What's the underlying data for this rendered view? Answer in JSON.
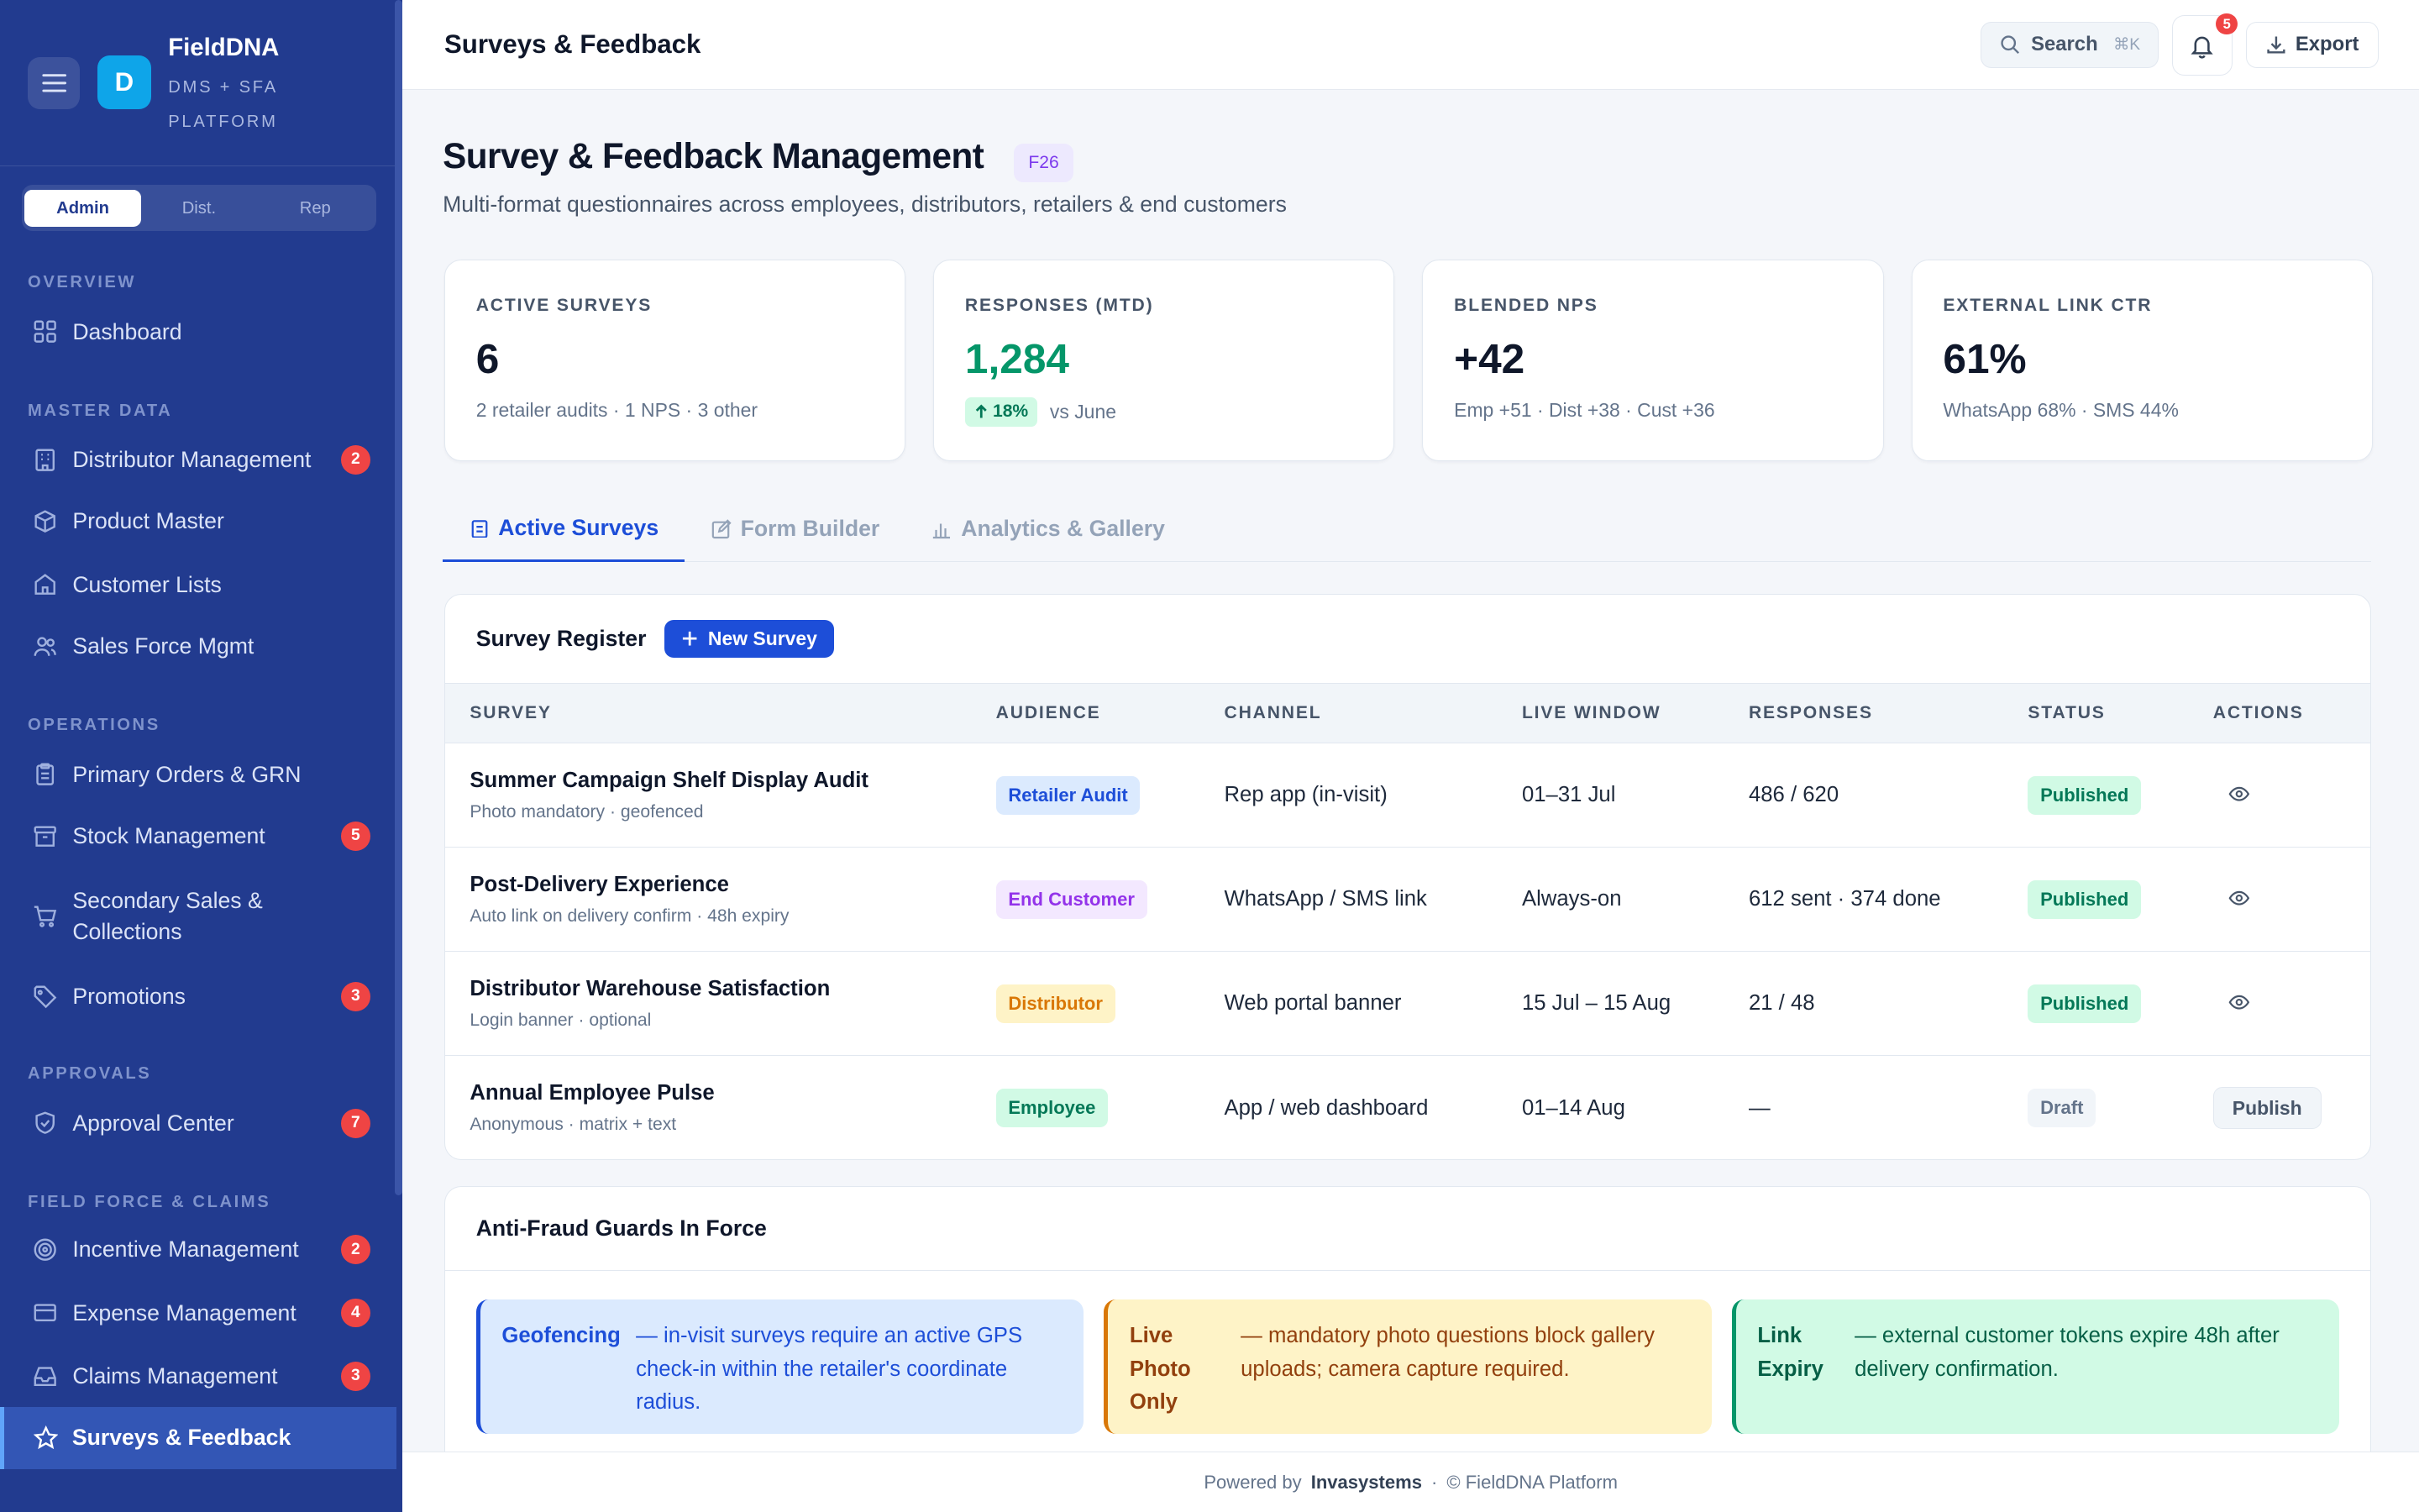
{
  "sidebar": {
    "brand": "FieldDNA",
    "brand_sub": "DMS + SFA PLATFORM",
    "logo_letter": "D",
    "roles": [
      "Admin",
      "Dist.",
      "Rep"
    ],
    "sections": {
      "overview": "OVERVIEW",
      "master": "MASTER DATA",
      "operations": "OPERATIONS",
      "approvals": "APPROVALS",
      "field": "FIELD FORCE & CLAIMS"
    },
    "items": [
      {
        "label": "Dashboard",
        "icon": "grid-icon"
      },
      {
        "label": "Distributor Management",
        "icon": "building-icon",
        "badge": "2"
      },
      {
        "label": "Product Master",
        "icon": "box-icon"
      },
      {
        "label": "Customer Lists",
        "icon": "store-icon"
      },
      {
        "label": "Sales Force Mgmt",
        "icon": "users-icon"
      },
      {
        "label": "Primary Orders & GRN",
        "icon": "clipboard-icon"
      },
      {
        "label": "Stock Management",
        "icon": "archive-icon",
        "badge": "5"
      },
      {
        "label": "Secondary Sales & Collections",
        "icon": "cart-icon"
      },
      {
        "label": "Promotions",
        "icon": "tag-icon",
        "badge": "3"
      },
      {
        "label": "Approval Center",
        "icon": "shield-check-icon",
        "badge": "7"
      },
      {
        "label": "Incentive Management",
        "icon": "target-icon",
        "badge": "2"
      },
      {
        "label": "Expense Management",
        "icon": "credit-card-icon",
        "badge": "4"
      },
      {
        "label": "Claims Management",
        "icon": "inbox-icon",
        "badge": "3"
      },
      {
        "label": "Surveys & Feedback",
        "icon": "star-icon"
      }
    ]
  },
  "topbar": {
    "title": "Surveys & Feedback",
    "search_label": "Search",
    "search_kbd": "⌘K",
    "notif_count": "5",
    "export_label": "Export"
  },
  "header": {
    "title": "Survey & Feedback Management",
    "tag": "F26",
    "subtitle": "Multi-format questionnaires across employees, distributors, retailers & end customers"
  },
  "kpis": [
    {
      "label": "ACTIVE SURVEYS",
      "value": "6",
      "sub": "2 retailer audits · 1 NPS · 3 other"
    },
    {
      "label": "RESPONSES (MTD)",
      "value": "1,284",
      "delta": "18%",
      "sub": "vs June"
    },
    {
      "label": "BLENDED NPS",
      "value": "+42",
      "sub": "Emp +51 · Dist +38 · Cust +36"
    },
    {
      "label": "EXTERNAL LINK CTR",
      "value": "61%",
      "sub": "WhatsApp 68% · SMS 44%"
    }
  ],
  "tabs": [
    "Active Surveys",
    "Form Builder",
    "Analytics & Gallery"
  ],
  "register": {
    "title": "Survey Register",
    "new_button": "New Survey",
    "columns": [
      "SURVEY",
      "AUDIENCE",
      "CHANNEL",
      "LIVE WINDOW",
      "RESPONSES",
      "STATUS",
      "ACTIONS"
    ],
    "rows": [
      {
        "title": "Summer Campaign Shelf Display Audit",
        "sub": "Photo mandatory · geofenced",
        "audience": "Retailer Audit",
        "channel": "Rep app (in-visit)",
        "window": "01–31 Jul",
        "responses": "486 / 620",
        "status": "Published"
      },
      {
        "title": "Post-Delivery Experience",
        "sub": "Auto link on delivery confirm · 48h expiry",
        "audience": "End Customer",
        "channel": "WhatsApp / SMS link",
        "window": "Always-on",
        "responses": "612 sent · 374 done",
        "status": "Published"
      },
      {
        "title": "Distributor Warehouse Satisfaction",
        "sub": "Login banner · optional",
        "audience": "Distributor",
        "channel": "Web portal banner",
        "window": "15 Jul – 15 Aug",
        "responses": "21 / 48",
        "status": "Published"
      },
      {
        "title": "Annual Employee Pulse",
        "sub": "Anonymous · matrix + text",
        "audience": "Employee",
        "channel": "App / web dashboard",
        "window": "01–14 Aug",
        "responses": "—",
        "status": "Draft",
        "action": "Publish"
      }
    ]
  },
  "guards": {
    "title": "Anti-Fraud Guards In Force",
    "items": [
      {
        "title": "Geofencing",
        "text": "— in-visit surveys require an active GPS check-in within the retailer's coordinate radius."
      },
      {
        "title": "Live Photo Only",
        "text": "— mandatory photo questions block gallery uploads; camera capture required."
      },
      {
        "title": "Link Expiry",
        "text": "— external customer tokens expire 48h after delivery confirmation."
      }
    ]
  },
  "footer": {
    "powered": "Powered by",
    "company": "Invasystems",
    "sep": "·",
    "copy": "© FieldDNA Platform"
  },
  "colors": {
    "sidebar": "#223b8f",
    "accent": "#1d4ed8",
    "success": "#059669",
    "danger": "#ef4444"
  }
}
